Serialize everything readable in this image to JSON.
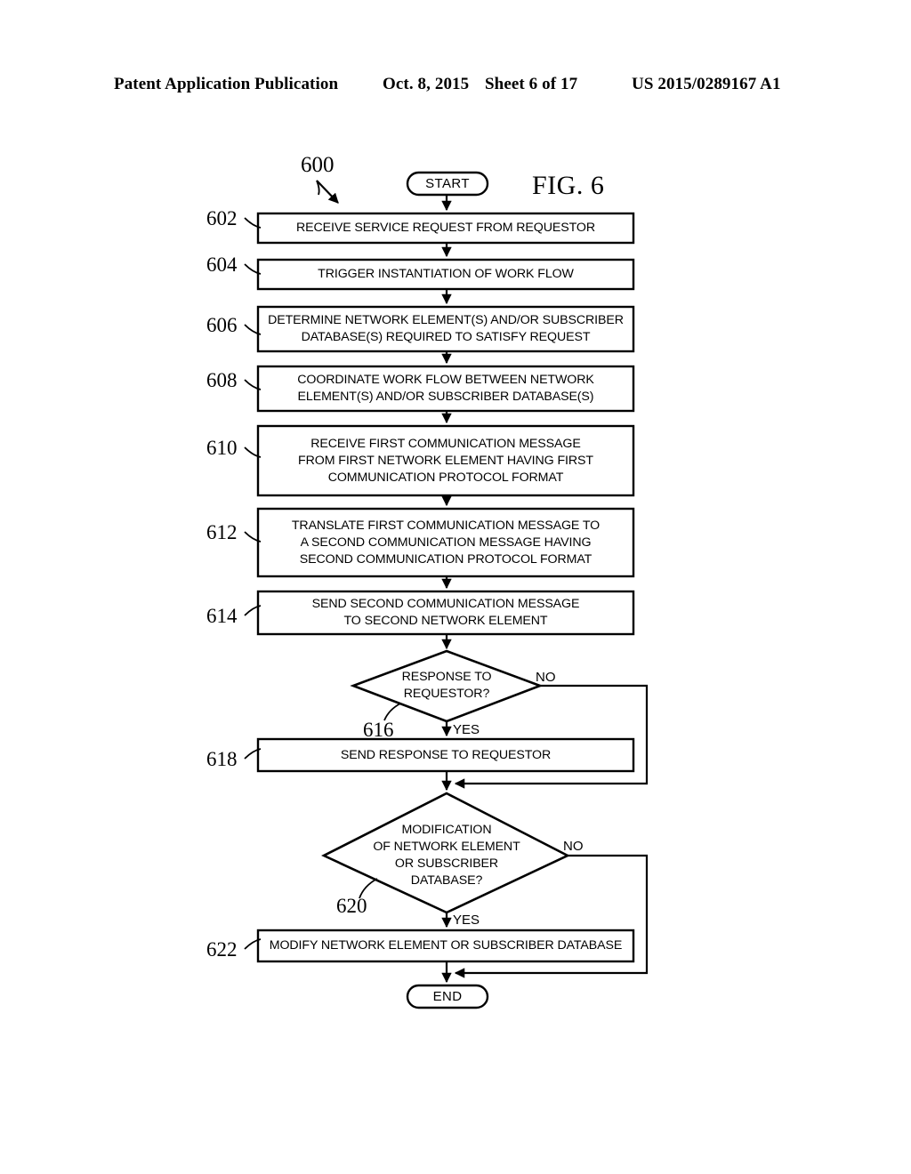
{
  "header": {
    "publication": "Patent Application Publication",
    "date": "Oct. 8, 2015",
    "sheet": "Sheet 6 of 17",
    "patent_number": "US 2015/0289167 A1"
  },
  "figure": {
    "label": "FIG. 6",
    "flow_number": "600"
  },
  "terminators": {
    "start": "START",
    "end": "END"
  },
  "edge_labels": {
    "no_1": "NO",
    "yes_1": "YES",
    "no_2": "NO",
    "yes_2": "YES"
  },
  "steps": [
    {
      "ref": "602",
      "text": "RECEIVE SERVICE REQUEST FROM REQUESTOR"
    },
    {
      "ref": "604",
      "text": "TRIGGER INSTANTIATION OF WORK FLOW"
    },
    {
      "ref": "606",
      "text": "DETERMINE NETWORK ELEMENT(S) AND/OR SUBSCRIBER\nDATABASE(S) REQUIRED TO SATISFY REQUEST"
    },
    {
      "ref": "608",
      "text": "COORDINATE WORK FLOW BETWEEN NETWORK\nELEMENT(S) AND/OR SUBSCRIBER DATABASE(S)"
    },
    {
      "ref": "610",
      "text": "RECEIVE FIRST COMMUNICATION MESSAGE\nFROM FIRST NETWORK ELEMENT HAVING FIRST\nCOMMUNICATION PROTOCOL FORMAT"
    },
    {
      "ref": "612",
      "text": "TRANSLATE FIRST COMMUNICATION MESSAGE TO\nA SECOND COMMUNICATION MESSAGE HAVING\nSECOND COMMUNICATION PROTOCOL FORMAT"
    },
    {
      "ref": "614",
      "text": "SEND SECOND COMMUNICATION MESSAGE\nTO SECOND NETWORK ELEMENT"
    },
    {
      "ref": "618",
      "text": "SEND RESPONSE TO REQUESTOR"
    },
    {
      "ref": "622",
      "text": "MODIFY NETWORK ELEMENT OR SUBSCRIBER DATABASE"
    }
  ],
  "decisions": [
    {
      "ref": "616",
      "text": "RESPONSE TO\nREQUESTOR?"
    },
    {
      "ref": "620",
      "text": "MODIFICATION\nOF NETWORK ELEMENT\nOR SUBSCRIBER\nDATABASE?"
    }
  ],
  "colors": {
    "ink": "#000000",
    "paper": "#ffffff"
  }
}
